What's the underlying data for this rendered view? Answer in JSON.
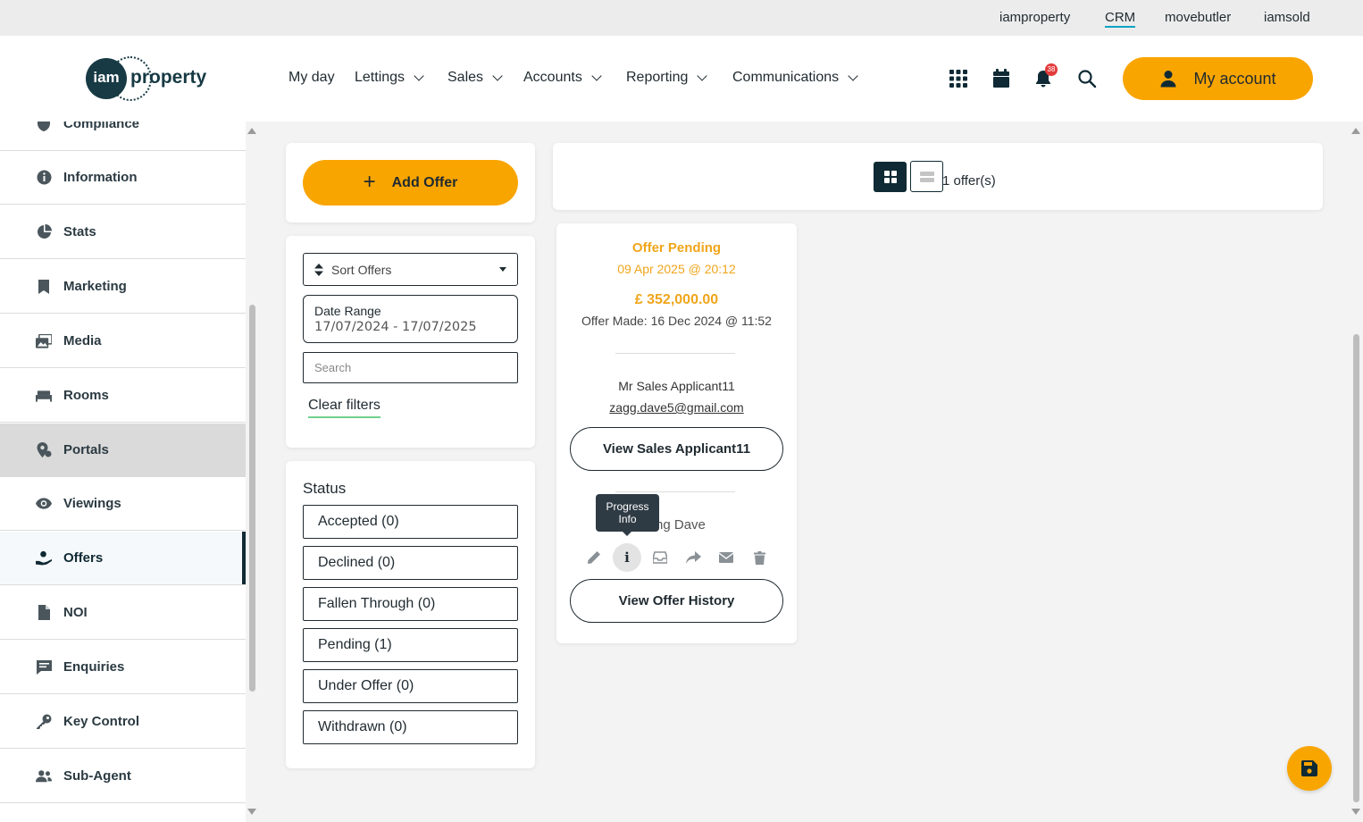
{
  "brand_links": [
    {
      "label": "iamproperty",
      "active": false
    },
    {
      "label": "CRM",
      "active": true
    },
    {
      "label": "movebutler",
      "active": false
    },
    {
      "label": "iamsold",
      "active": false
    }
  ],
  "logo": {
    "mark": "iam",
    "text": "property"
  },
  "nav": [
    {
      "label": "My day",
      "dropdown": false
    },
    {
      "label": "Lettings",
      "dropdown": true
    },
    {
      "label": "Sales",
      "dropdown": true
    },
    {
      "label": "Accounts",
      "dropdown": true
    },
    {
      "label": "Reporting",
      "dropdown": true
    },
    {
      "label": "Communications",
      "dropdown": true
    }
  ],
  "header_icons": [
    "apps-grid-icon",
    "calendar-icon",
    "bell-icon",
    "search-icon"
  ],
  "notifications_count": "38",
  "my_account_label": "My account",
  "sidebar": {
    "items": [
      {
        "label": "Compliance",
        "icon": "shield-icon"
      },
      {
        "label": "Information",
        "icon": "info-icon"
      },
      {
        "label": "Stats",
        "icon": "pie-chart-icon"
      },
      {
        "label": "Marketing",
        "icon": "bookmark-icon"
      },
      {
        "label": "Media",
        "icon": "images-icon"
      },
      {
        "label": "Rooms",
        "icon": "bed-icon"
      },
      {
        "label": "Portals",
        "icon": "map-pin-icon"
      },
      {
        "label": "Viewings",
        "icon": "eye-icon"
      },
      {
        "label": "Offers",
        "icon": "hand-offer-icon"
      },
      {
        "label": "NOI",
        "icon": "document-icon"
      },
      {
        "label": "Enquiries",
        "icon": "message-icon"
      },
      {
        "label": "Key Control",
        "icon": "key-icon"
      },
      {
        "label": "Sub-Agent",
        "icon": "users-icon"
      }
    ],
    "highlighted": "Portals",
    "active": "Offers"
  },
  "filters": {
    "add_offer_label": "Add Offer",
    "sort_label": "Sort Offers",
    "date_range_label": "Date Range",
    "date_range_value": "17/07/2024 - 17/07/2025",
    "search_placeholder": "Search",
    "clear_filters_label": "Clear filters"
  },
  "status": {
    "title": "Status",
    "options": [
      "Accepted (0)",
      "Declined (0)",
      "Fallen Through (0)",
      "Pending (1)",
      "Under Offer (0)",
      "Withdrawn (0)"
    ]
  },
  "results": {
    "count_label": "1 offer(s)",
    "view_mode": "grid"
  },
  "offer_card": {
    "status": "Offer Pending",
    "status_date": "09 Apr 2025 @ 20:12",
    "amount": "£ 352,000.00",
    "offer_made": "Offer Made: 16 Dec 2024 @ 11:52",
    "applicant_name": "Mr Sales Applicant11",
    "applicant_email": "zagg.dave5@gmail.com",
    "view_applicant_label": "View Sales Applicant11",
    "negotiator": "ining Dave",
    "actions": [
      "pencil-icon",
      "info-icon",
      "inbox-icon",
      "share-icon",
      "mail-icon",
      "trash-icon"
    ],
    "info_glyph": "i",
    "view_history_label": "View Offer History"
  },
  "tooltip": {
    "line1": "Progress",
    "line2": "Info"
  },
  "colors": {
    "accent": "#f9a500",
    "dark": "#0f2a34",
    "pending": "#f0a51a"
  }
}
